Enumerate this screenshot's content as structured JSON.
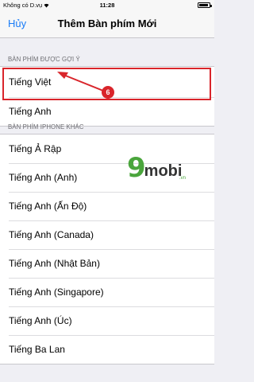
{
  "status_bar": {
    "carrier": "Không có D.vụ",
    "time": "11:28",
    "battery_level": 0.9
  },
  "nav": {
    "cancel_label": "Hủy",
    "title": "Thêm Bàn phím Mới"
  },
  "suggested": {
    "header": "BÀN PHÍM ĐƯỢC GỢI Ý",
    "items": [
      "Tiếng Việt",
      "Tiếng Anh"
    ]
  },
  "other": {
    "header": "BÀN PHÍM IPHONE KHÁC",
    "items": [
      "Tiếng Ả Rập",
      "Tiếng Anh (Anh)",
      "Tiếng Anh (Ấn Độ)",
      "Tiếng Anh (Canada)",
      "Tiếng Anh (Nhật Bản)",
      "Tiếng Anh (Singapore)",
      "Tiếng Anh (Úc)",
      "Tiếng Ba Lan"
    ]
  },
  "annotation": {
    "step_number": "6",
    "color": "#d9252b"
  },
  "watermark": {
    "digit": "9",
    "text": "mobi",
    "suffix": ".vn"
  },
  "colors": {
    "accent": "#1a7cf7",
    "background": "#efeff4"
  }
}
